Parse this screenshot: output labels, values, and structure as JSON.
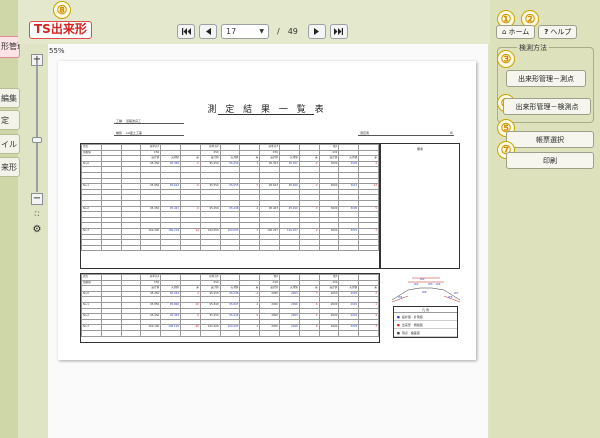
{
  "app_title": "TS出来形",
  "callouts": [
    "①",
    "②",
    "③",
    "④",
    "⑤",
    "⑦",
    "⑧"
  ],
  "left_menu": [
    {
      "label": "形管理",
      "active": true
    },
    {
      "label": "編集",
      "active": false
    },
    {
      "label": "定",
      "active": false
    },
    {
      "label": "イル",
      "active": false
    },
    {
      "label": "来形",
      "active": false
    }
  ],
  "nav": {
    "first_icon": "first-page-icon",
    "prev_icon": "prev-page-icon",
    "current_page": "17",
    "separator": "/",
    "total_pages": "49",
    "next_icon": "next-page-icon",
    "last_icon": "last-page-icon"
  },
  "zoom": {
    "level": "55%",
    "plus": "+",
    "minus": "−",
    "level_fraction": 0.55
  },
  "document": {
    "title": "測 定 結 果 一 覧 表",
    "info_rows": [
      {
        "label": "工種",
        "value": "道路改良工"
      },
      {
        "label": "種別",
        "value": "LO盛土工事"
      }
    ],
    "right_label": "測定者",
    "right_end": "印",
    "remarks_header": "備考",
    "legend": {
      "header": "凡 例",
      "items": [
        "設計値 · 計測値",
        "出来形 · 規格値",
        "測点 · 偏差値"
      ]
    },
    "section_labels": [
      "W2",
      "W2",
      "W3",
      "W4",
      "W1",
      "W5",
      "W6",
      "W7"
    ],
    "table1": [
      [
        "測点",
        "",
        "",
        "基準高1",
        "",
        "",
        "基準高2",
        "",
        "",
        "基準高3",
        "",
        "",
        "幅1",
        "",
        ""
      ],
      [
        "規格値",
        "",
        "",
        "±50",
        "",
        "",
        "±50",
        "",
        "",
        "±50",
        "",
        "",
        "-100",
        "",
        ""
      ],
      [
        "",
        "",
        "",
        "設計値",
        "実測値",
        "差",
        "設計値",
        "実測値",
        "差",
        "設計値",
        "実測値",
        "差",
        "設計値",
        "実測値",
        "差"
      ],
      [
        "No.0",
        "",
        "",
        "95.350",
        "95.348",
        "-2",
        "95.250",
        "95.252",
        "2",
        "95.303",
        "95.301",
        "-2",
        "3000",
        "3004",
        "4"
      ],
      [
        "No.1",
        "",
        "",
        "95.650",
        "95.644",
        "-6",
        "95.550",
        "95.555",
        "5",
        "95.603",
        "95.600",
        "-3",
        "3000",
        "3012",
        "12"
      ],
      [
        "No.2",
        "",
        "",
        "95.450",
        "95.441",
        "-9",
        "95.450",
        "95.448",
        "-2",
        "95.403",
        "95.400",
        "-3",
        "3000",
        "3005",
        "5"
      ],
      [
        "No.3",
        "",
        "",
        "100.205",
        "100.219",
        "14",
        "100.050",
        "100.053",
        "3",
        "100.257",
        "100.257",
        "0",
        "3000",
        "3001",
        "1"
      ]
    ],
    "table2": [
      [
        "測点",
        "",
        "",
        "基準高4",
        "",
        "",
        "基準高5",
        "",
        "",
        "幅2",
        "",
        "",
        "幅3",
        "",
        ""
      ],
      [
        "規格値",
        "",
        "",
        "±50",
        "",
        "",
        "±50",
        "",
        "",
        "-100",
        "",
        "",
        "-100",
        "",
        ""
      ],
      [
        "",
        "",
        "",
        "設計値",
        "実測値",
        "差",
        "設計値",
        "実測値",
        "差",
        "設計値",
        "実測値",
        "差",
        "設計値",
        "実測値",
        "差"
      ],
      [
        "No.0",
        "",
        "",
        "95.250",
        "95.254",
        "4",
        "95.250",
        "95.246",
        "-4",
        "2000",
        "2003",
        "3",
        "2000",
        "2002",
        "2"
      ],
      [
        "No.1",
        "",
        "",
        "95.850",
        "95.860",
        "10",
        "95.849",
        "95.847",
        "-2",
        "2000",
        "2006",
        "6",
        "2000",
        "2001",
        "1"
      ],
      [
        "No.2",
        "",
        "",
        "95.450",
        "95.459",
        "9",
        "95.450",
        "95.445",
        "-5",
        "2000",
        "2005",
        "5",
        "2000",
        "2004",
        "4"
      ],
      [
        "No.3",
        "",
        "",
        "100.100",
        "100.145",
        "45",
        "100.400",
        "100.402",
        "2",
        "2000",
        "2008",
        "8",
        "2000",
        "2003",
        "3"
      ]
    ]
  },
  "right_panel": {
    "home_label": "ホーム",
    "home_icon": "home-icon",
    "help_label": "ヘルプ",
    "help_icon": "help-icon",
    "group_title": "検測方法",
    "btn_measure_point": "出来形管理－測点",
    "btn_inspect_point": "出来形管理－検測点",
    "btn_select_form": "帳票選択",
    "btn_print": "印刷"
  }
}
